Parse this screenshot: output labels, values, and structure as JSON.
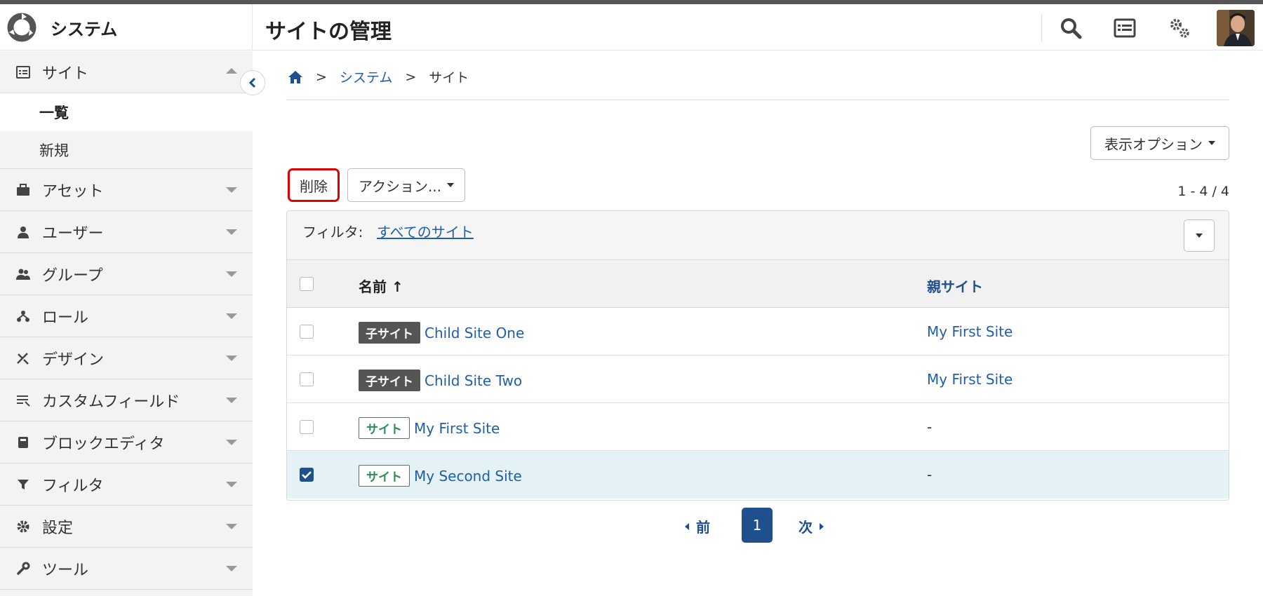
{
  "app": {
    "name": "システム",
    "page_title": "サイトの管理"
  },
  "header": {
    "icons": [
      "search-icon",
      "list-icon",
      "gears-icon"
    ]
  },
  "sidebar": {
    "site": {
      "label": "サイト",
      "sub": [
        {
          "label": "一覧"
        },
        {
          "label": "新規"
        }
      ]
    },
    "items": [
      {
        "label": "アセット",
        "icon": "briefcase-icon"
      },
      {
        "label": "ユーザー",
        "icon": "user-icon"
      },
      {
        "label": "グループ",
        "icon": "group-icon"
      },
      {
        "label": "ロール",
        "icon": "role-icon"
      },
      {
        "label": "デザイン",
        "icon": "design-icon"
      },
      {
        "label": "カスタムフィールド",
        "icon": "custom-field-icon"
      },
      {
        "label": "ブロックエディタ",
        "icon": "block-editor-icon"
      },
      {
        "label": "フィルタ",
        "icon": "filter-icon"
      },
      {
        "label": "設定",
        "icon": "gear-icon"
      },
      {
        "label": "ツール",
        "icon": "wrench-icon"
      }
    ]
  },
  "breadcrumb": {
    "sep": ">",
    "system": "システム",
    "current": "サイト"
  },
  "toolbar": {
    "display_options": "表示オプション",
    "delete": "削除",
    "actions": "アクション...",
    "count": "1 - 4 / 4"
  },
  "filter": {
    "label": "フィルタ:",
    "value": "すべてのサイト"
  },
  "table": {
    "headers": {
      "name": "名前 ↑",
      "parent": "親サイト"
    },
    "rows": [
      {
        "badge": "子サイト",
        "badge_style": "dark",
        "name": "Child Site One",
        "parent": "My First Site",
        "checked": false
      },
      {
        "badge": "子サイト",
        "badge_style": "dark",
        "name": "Child Site Two",
        "parent": "My First Site",
        "checked": false
      },
      {
        "badge": "サイト",
        "badge_style": "light",
        "name": "My First Site",
        "parent": "-",
        "checked": false
      },
      {
        "badge": "サイト",
        "badge_style": "light",
        "name": "My Second Site",
        "parent": "-",
        "checked": true
      }
    ]
  },
  "pager": {
    "prev": "前",
    "current": "1",
    "next": "次"
  },
  "colors": {
    "accent": "#1f4f8c",
    "link": "#1f5fa8",
    "highlight": "#e10000",
    "selected_row": "#e4f1f5"
  }
}
